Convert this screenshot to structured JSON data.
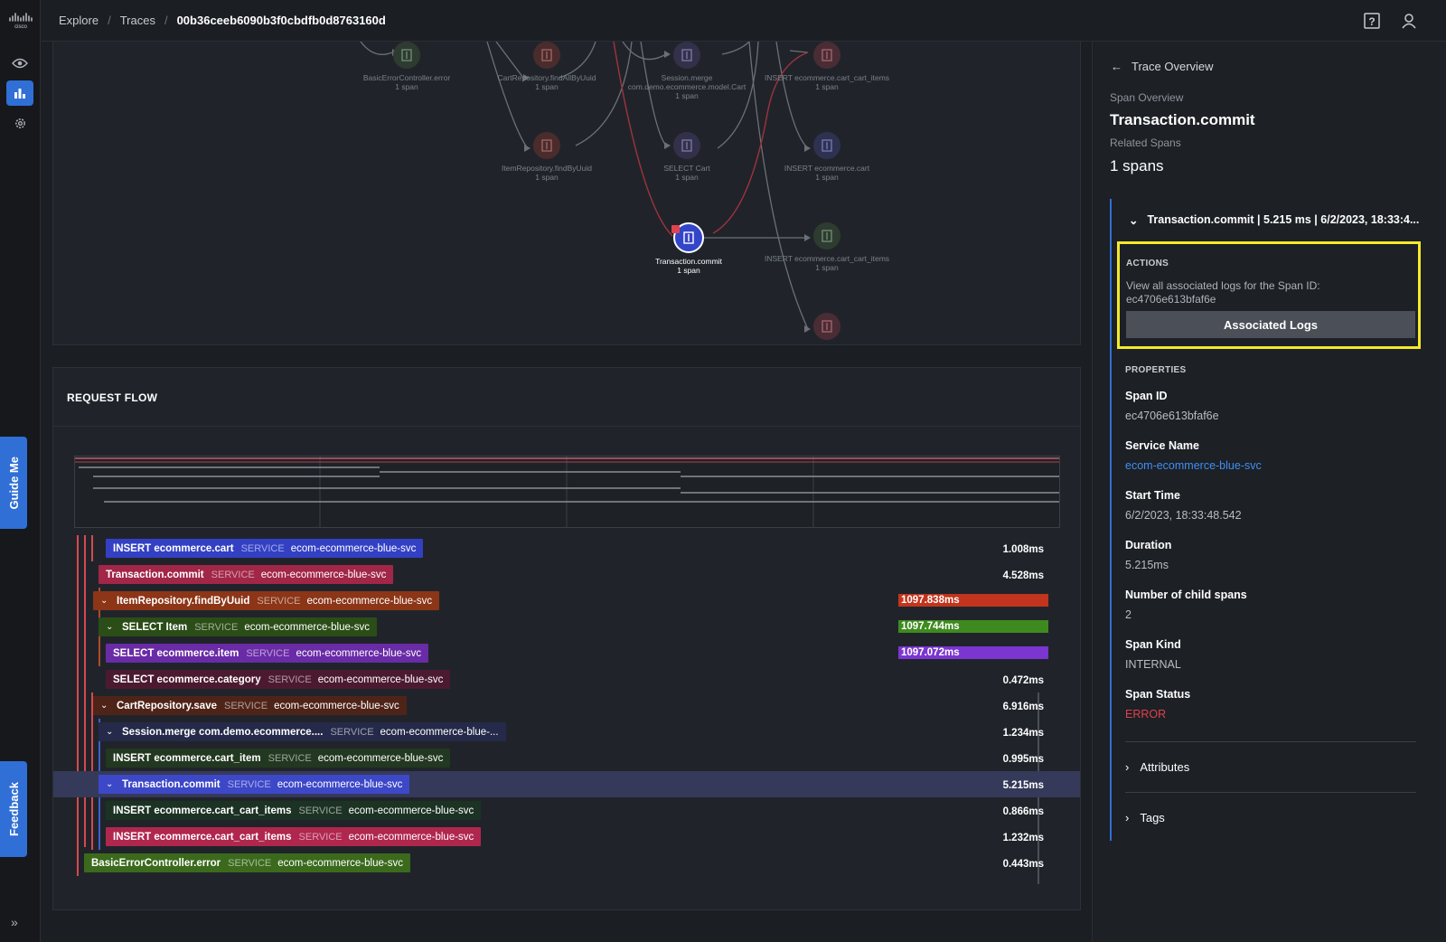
{
  "breadcrumbs": {
    "explore": "Explore",
    "traces": "Traces",
    "trace_id": "00b36ceeb6090b3f0cbdfb0d8763160d"
  },
  "rail": {
    "guide_me": "Guide Me",
    "feedback": "Feedback"
  },
  "graph": {
    "nodes": [
      {
        "name": "BasicErrorController.error",
        "count": "1 span"
      },
      {
        "name": "CartRepository.findAllByUuid",
        "count": "1 span"
      },
      {
        "name": "Session.merge",
        "name2": "com.demo.ecommerce.model.Cart",
        "count": "1 span"
      },
      {
        "name": "INSERT ecommerce.cart_cart_items",
        "count": "1 span"
      },
      {
        "name": "ItemRepository.findByUuid",
        "count": "1 span"
      },
      {
        "name": "SELECT Cart",
        "count": "1 span"
      },
      {
        "name": "INSERT ecommerce.cart",
        "count": "1 span"
      },
      {
        "name": "Transaction.commit",
        "count": "1 span"
      },
      {
        "name": "INSERT ecommerce.cart_cart_items",
        "count": "1 span"
      }
    ]
  },
  "flow": {
    "title": "REQUEST FLOW",
    "service_label": "SERVICE",
    "rows": [
      {
        "op": "INSERT ecommerce.cart",
        "svc": "ecom-ecommerce-blue-svc",
        "dur": "1.008ms"
      },
      {
        "op": "Transaction.commit",
        "svc": "ecom-ecommerce-blue-svc",
        "dur": "4.528ms"
      },
      {
        "op": "ItemRepository.findByUuid",
        "svc": "ecom-ecommerce-blue-svc",
        "dur": "1097.838ms"
      },
      {
        "op": "SELECT Item",
        "svc": "ecom-ecommerce-blue-svc",
        "dur": "1097.744ms"
      },
      {
        "op": "SELECT ecommerce.item",
        "svc": "ecom-ecommerce-blue-svc",
        "dur": "1097.072ms"
      },
      {
        "op": "SELECT ecommerce.category",
        "svc": "ecom-ecommerce-blue-svc",
        "dur": "0.472ms"
      },
      {
        "op": "CartRepository.save",
        "svc": "ecom-ecommerce-blue-svc",
        "dur": "6.916ms"
      },
      {
        "op": "Session.merge com.demo.ecommerce....",
        "svc": "ecom-ecommerce-blue-...",
        "dur": "1.234ms"
      },
      {
        "op": "INSERT ecommerce.cart_item",
        "svc": "ecom-ecommerce-blue-svc",
        "dur": "0.995ms"
      },
      {
        "op": "Transaction.commit",
        "svc": "ecom-ecommerce-blue-svc",
        "dur": "5.215ms"
      },
      {
        "op": "INSERT ecommerce.cart_cart_items",
        "svc": "ecom-ecommerce-blue-svc",
        "dur": "0.866ms"
      },
      {
        "op": "INSERT ecommerce.cart_cart_items",
        "svc": "ecom-ecommerce-blue-svc",
        "dur": "1.232ms"
      },
      {
        "op": "BasicErrorController.error",
        "svc": "ecom-ecommerce-blue-svc",
        "dur": "0.443ms"
      }
    ]
  },
  "panel": {
    "back_label": "Trace Overview",
    "span_overview_label": "Span Overview",
    "span_name": "Transaction.commit",
    "related_label": "Related Spans",
    "related_value": "1 spans",
    "span_header": "Transaction.commit | 5.215 ms | 6/2/2023, 18:33:4...",
    "actions_label": "ACTIONS",
    "actions_text": "View all associated logs for the Span ID: ec4706e613bfaf6e",
    "logs_button": "Associated Logs",
    "properties_label": "PROPERTIES",
    "props": {
      "span_id_k": "Span ID",
      "span_id_v": "ec4706e613bfaf6e",
      "service_k": "Service Name",
      "service_v": "ecom-ecommerce-blue-svc",
      "start_k": "Start Time",
      "start_v": "6/2/2023, 18:33:48.542",
      "duration_k": "Duration",
      "duration_v": "5.215ms",
      "children_k": "Number of child spans",
      "children_v": "2",
      "kind_k": "Span Kind",
      "kind_v": "INTERNAL",
      "status_k": "Span Status",
      "status_v": "ERROR"
    },
    "attributes_label": "Attributes",
    "tags_label": "Tags"
  },
  "colors": {
    "accent": "#2f6fd6",
    "highlight": "#f6e92a",
    "error": "#e0424f",
    "link": "#3f8ef5"
  }
}
